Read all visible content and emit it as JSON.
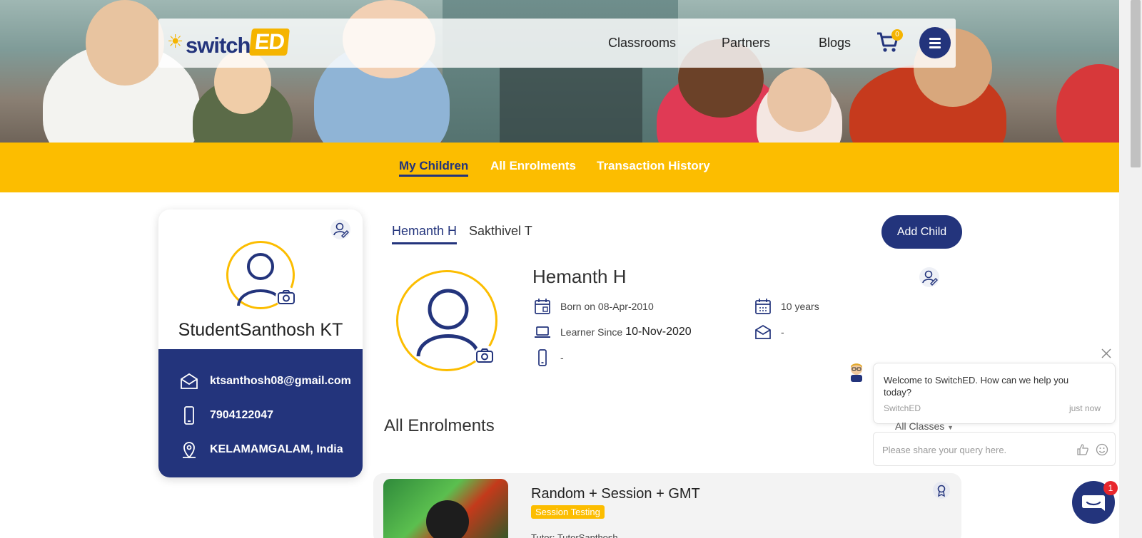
{
  "header": {
    "logo_text_switch": "switch",
    "logo_text_ed": "ED",
    "nav": [
      {
        "label": "Classrooms"
      },
      {
        "label": "Partners"
      },
      {
        "label": "Blogs"
      }
    ],
    "cart_count": "0"
  },
  "tabs": {
    "my_children": "My Children",
    "all_enrolments": "All Enrolments",
    "transaction_history": "Transaction History",
    "active": "My Children"
  },
  "profile": {
    "name": "StudentSanthosh KT",
    "email": "ktsanthosh08@gmail.com",
    "phone": "7904122047",
    "location": "KELAMAMGALAM, India"
  },
  "children": {
    "tabs": [
      "Hemanth H",
      "Sakthivel T"
    ],
    "active": "Hemanth H",
    "add_button": "Add Child",
    "selected": {
      "name": "Hemanth H",
      "born": "Born on 08-Apr-2010",
      "age": "10 years",
      "learner_since_label": "Learner Since",
      "learner_since": "10-Nov-2020",
      "email": "-",
      "phone": "-"
    }
  },
  "enrolments": {
    "title": "All Enrolments",
    "items": [
      {
        "title": "Random + Session + GMT",
        "tag": "Session Testing",
        "tutor": "Tutor: TutorSanthosh"
      }
    ]
  },
  "chat": {
    "message": "Welcome to SwitchED. How can we help you today?",
    "from": "SwitchED",
    "time": "just now",
    "filter": "All Classes",
    "input_placeholder": "Please share your query here.",
    "unread": "1"
  },
  "colors": {
    "brand_blue": "#23347c",
    "brand_yellow": "#fcbd00"
  }
}
